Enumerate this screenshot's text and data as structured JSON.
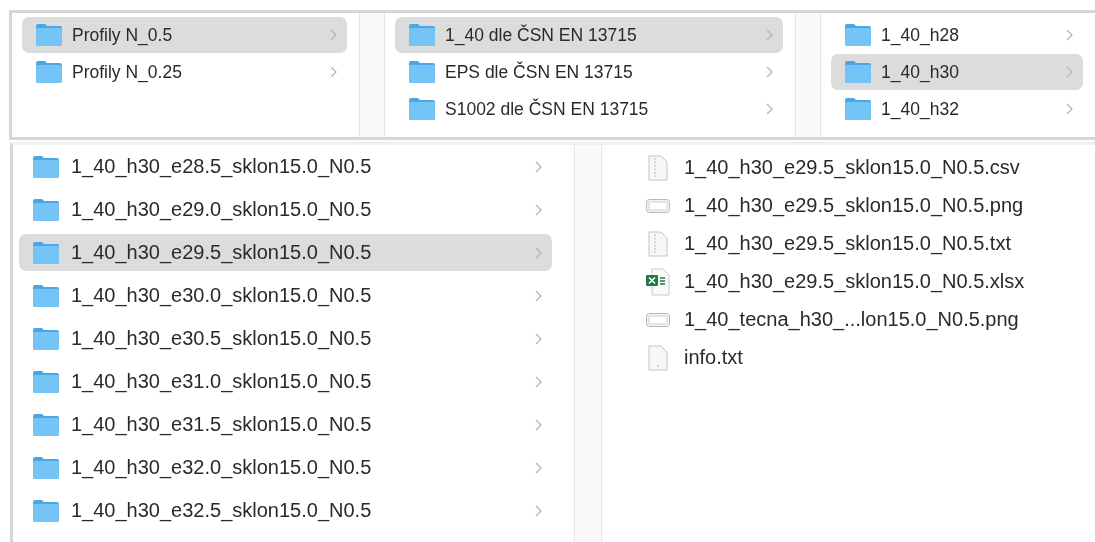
{
  "top_columns": [
    {
      "items": [
        {
          "label": "Profily N_0.5",
          "selected": true
        },
        {
          "label": "Profily N_0.25",
          "selected": false
        }
      ]
    },
    {
      "items": [
        {
          "label": "1_40 dle ČSN EN 13715",
          "selected": true
        },
        {
          "label": "EPS dle ČSN EN 13715",
          "selected": false
        },
        {
          "label": "S1002 dle ČSN EN 13715",
          "selected": false
        }
      ]
    },
    {
      "items": [
        {
          "label": "1_40_h28",
          "selected": false
        },
        {
          "label": "1_40_h30",
          "selected": true
        },
        {
          "label": "1_40_h32",
          "selected": false
        }
      ]
    }
  ],
  "folders": [
    {
      "label": "1_40_h30_e28.5_sklon15.0_N0.5",
      "selected": false
    },
    {
      "label": "1_40_h30_e29.0_sklon15.0_N0.5",
      "selected": false
    },
    {
      "label": "1_40_h30_e29.5_sklon15.0_N0.5",
      "selected": true
    },
    {
      "label": "1_40_h30_e30.0_sklon15.0_N0.5",
      "selected": false
    },
    {
      "label": "1_40_h30_e30.5_sklon15.0_N0.5",
      "selected": false
    },
    {
      "label": "1_40_h30_e31.0_sklon15.0_N0.5",
      "selected": false
    },
    {
      "label": "1_40_h30_e31.5_sklon15.0_N0.5",
      "selected": false
    },
    {
      "label": "1_40_h30_e32.0_sklon15.0_N0.5",
      "selected": false
    },
    {
      "label": "1_40_h30_e32.5_sklon15.0_N0.5",
      "selected": false
    }
  ],
  "files": [
    {
      "label": "1_40_h30_e29.5_sklon15.0_N0.5.csv",
      "kind": "data"
    },
    {
      "label": "1_40_h30_e29.5_sklon15.0_N0.5.png",
      "kind": "image"
    },
    {
      "label": "1_40_h30_e29.5_sklon15.0_N0.5.txt",
      "kind": "data"
    },
    {
      "label": "1_40_h30_e29.5_sklon15.0_N0.5.xlsx",
      "kind": "spreadsheet"
    },
    {
      "label": "1_40_tecna_h30_...lon15.0_N0.5.png",
      "kind": "image"
    },
    {
      "label": "info.txt",
      "kind": "text"
    }
  ]
}
